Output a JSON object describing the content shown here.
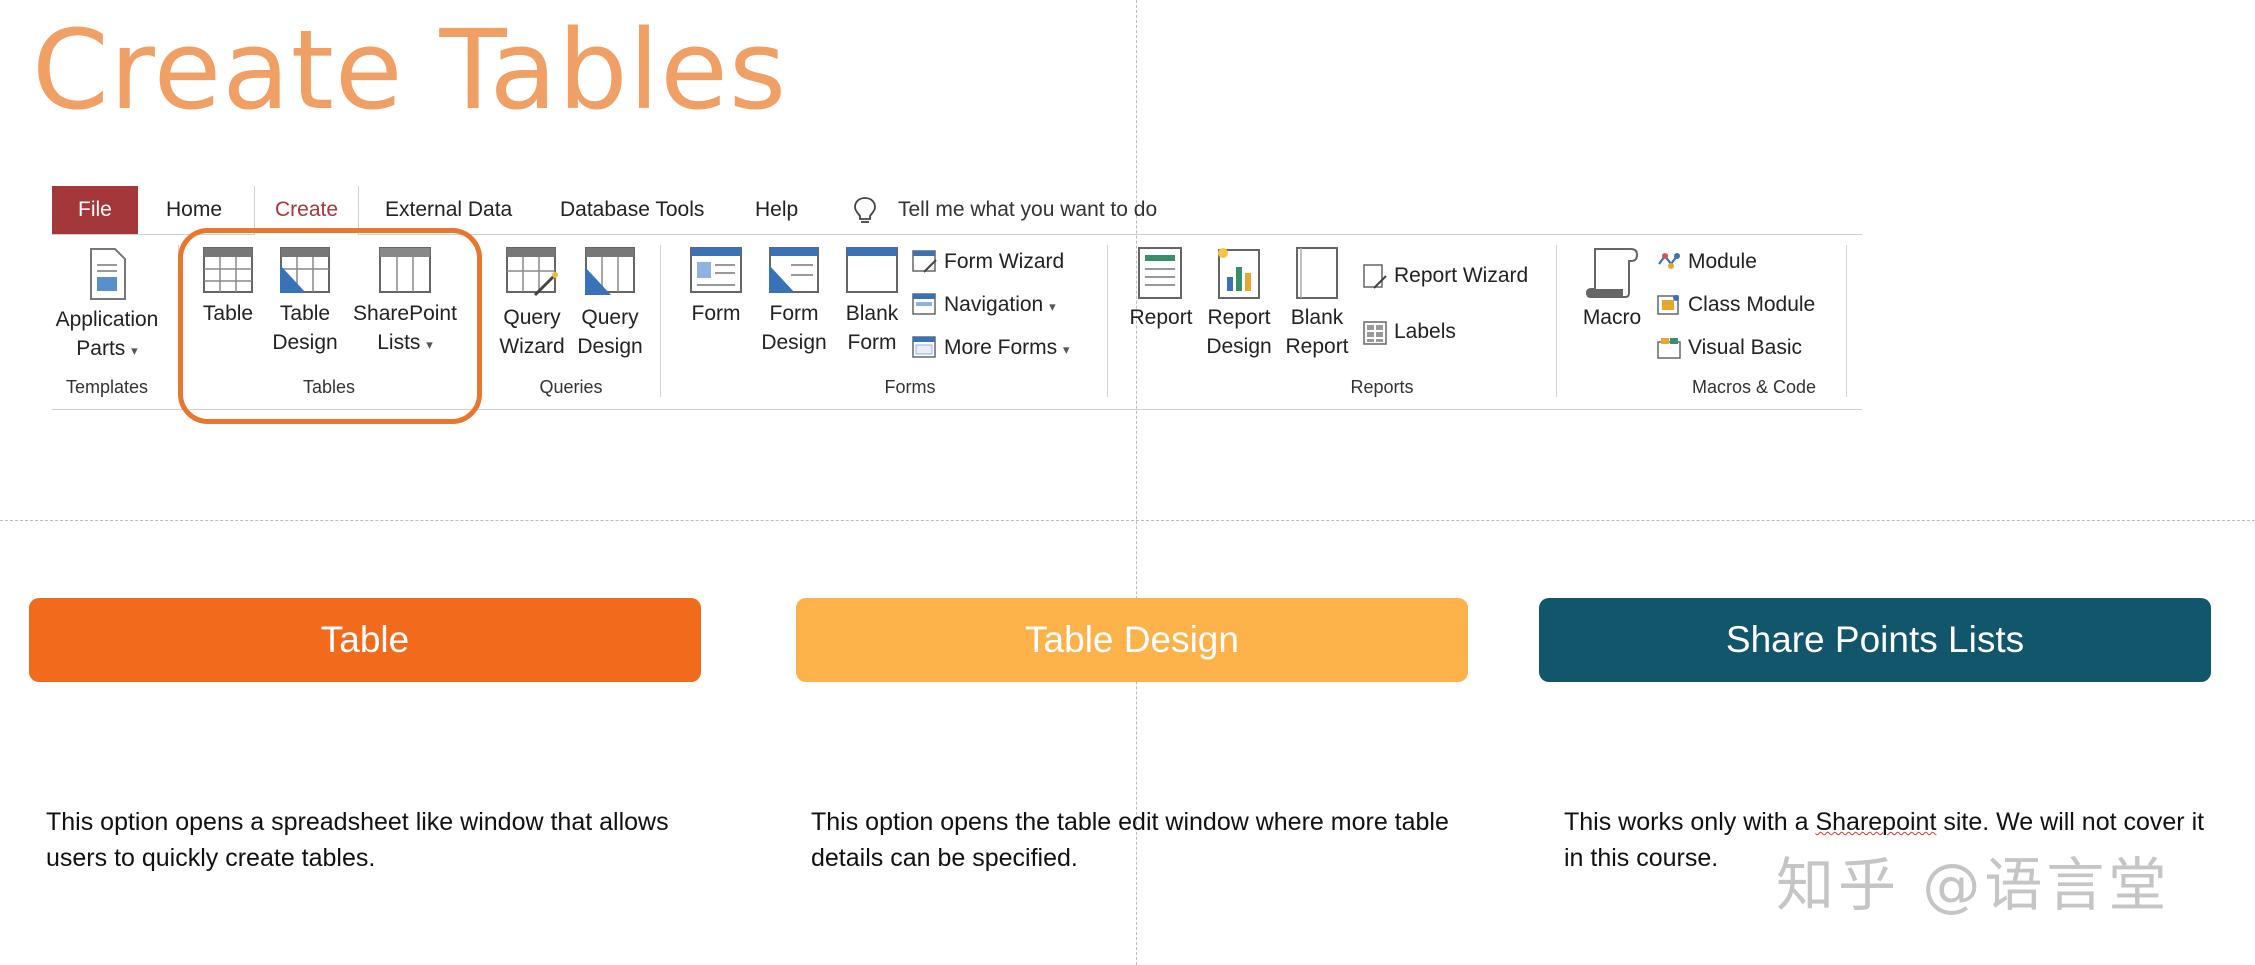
{
  "title": "Create Tables",
  "ribbon": {
    "tabs": [
      "File",
      "Home",
      "Create",
      "External Data",
      "Database Tools",
      "Help"
    ],
    "active_tab": "Create",
    "tell_me": "Tell me what you want to do",
    "groups": {
      "templates": {
        "label": "Templates",
        "application_parts": [
          "Application",
          "Parts"
        ]
      },
      "tables": {
        "label": "Tables",
        "table": [
          "Table"
        ],
        "table_design": [
          "Table",
          "Design"
        ],
        "sharepoint_lists": [
          "SharePoint",
          "Lists"
        ]
      },
      "queries": {
        "label": "Queries",
        "query_wizard": [
          "Query",
          "Wizard"
        ],
        "query_design": [
          "Query",
          "Design"
        ]
      },
      "forms": {
        "label": "Forms",
        "form": [
          "Form"
        ],
        "form_design": [
          "Form",
          "Design"
        ],
        "blank_form": [
          "Blank",
          "Form"
        ],
        "form_wizard": "Form Wizard",
        "navigation": "Navigation",
        "more_forms": "More Forms"
      },
      "reports": {
        "label": "Reports",
        "report": [
          "Report"
        ],
        "report_design": [
          "Report",
          "Design"
        ],
        "blank_report": [
          "Blank",
          "Report"
        ],
        "report_wizard": "Report Wizard",
        "labels": "Labels"
      },
      "macros": {
        "label": "Macros & Code",
        "macro": [
          "Macro"
        ],
        "module": "Module",
        "class_module": "Class Module",
        "visual_basic": "Visual Basic"
      }
    }
  },
  "cards": [
    {
      "title": "Table",
      "color": "#f26b1d",
      "description": "This option opens a spreadsheet like window that allows users to quickly create tables."
    },
    {
      "title": "Table Design",
      "color": "#fdb24a",
      "description": "This option opens the table edit window where more table details can be specified."
    },
    {
      "title": "Share Points Lists",
      "color": "#11566a",
      "description_parts": [
        "This works only with a ",
        "Sharepoint",
        " site.  We will not cover it in this course."
      ]
    }
  ],
  "watermark": "知乎 @语言堂"
}
